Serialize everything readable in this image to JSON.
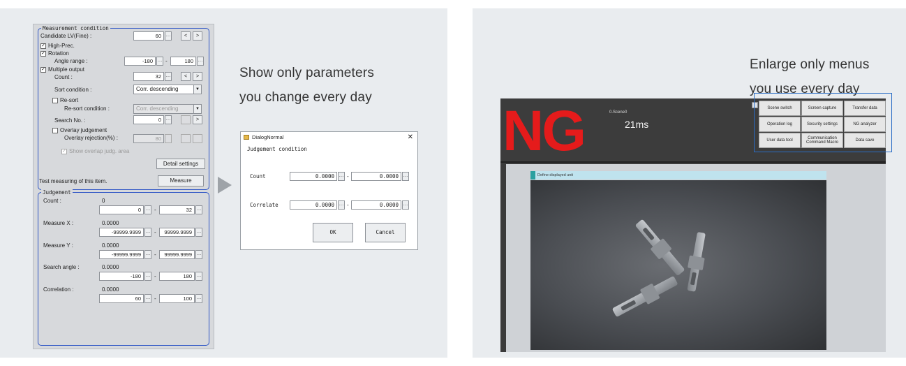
{
  "left_captions": [
    "Show only parameters",
    "you change every day"
  ],
  "right_captions": [
    "Enlarge only menus",
    "you use every day"
  ],
  "measurement": {
    "group_title": "Measurement condition",
    "candidate_label": "Candidate LV(Fine) :",
    "candidate_value": "60",
    "high_prec_label": "High-Prec.",
    "rotation_label": "Rotation",
    "angle_range_label": "Angle range :",
    "angle_min": "-180",
    "angle_max": "180",
    "multiple_output_label": "Multiple output",
    "count_label": "Count :",
    "count_value": "32",
    "sort_label": "Sort condition :",
    "sort_value": "Corr. descending",
    "resort_label": "Re-sort",
    "resort_condition_label": "Re-sort condition :",
    "resort_value": "Corr. descending",
    "search_no_label": "Search No. :",
    "search_no_value": "0",
    "overlay_judgement_label": "Overlay judgement",
    "overlay_rejection_label": "Overlay rejection(%) :",
    "overlay_rejection_value": "80",
    "show_overlap_label": "Show overlap judg. area",
    "detail_button": "Detail settings",
    "prev_glyph": "<",
    "next_glyph": ">"
  },
  "test_label": "Test measuring of this item.",
  "measure_button": "Measure",
  "judgement": {
    "group_title": "Judgement",
    "count_label": "Count :",
    "count_value": "0",
    "count_min": "0",
    "count_max": "32",
    "mx_label": "Measure X :",
    "mx_value": "0.0000",
    "mx_min": "-99999.9999",
    "mx_max": "99999.9999",
    "my_label": "Measure Y :",
    "my_value": "0.0000",
    "my_min": "-99999.9999",
    "my_max": "99999.9999",
    "angle_label": "Search angle :",
    "angle_value": "0.0000",
    "angle_min": "-180",
    "angle_max": "180",
    "corr_label": "Correlation :",
    "corr_value": "0.0000",
    "corr_min": "60",
    "corr_max": "100"
  },
  "dialog": {
    "title": "DialogNormal",
    "close": "✕",
    "section": "Judgement condition",
    "count_label": "Count",
    "count_min": "0.0000",
    "count_max": "0.0000",
    "corr_label": "Correlate",
    "corr_min": "0.0000",
    "corr_max": "0.0000",
    "ok": "OK",
    "cancel": "Cancel"
  },
  "screen": {
    "result": "NG",
    "scene": "0.Scene0",
    "time": "21ms",
    "unit_bar": "Define displayed unit",
    "menu": [
      "Scene switch",
      "Screen capture",
      "Transfer data",
      "Operation log",
      "Security settings",
      "NG analyzer",
      "User data tool",
      "Communication Command Macro",
      "Data save"
    ]
  },
  "colors": {
    "accent_blue": "#2f56c6",
    "ng_red": "#e51b1b",
    "panel_bg": "#e9ecef"
  }
}
